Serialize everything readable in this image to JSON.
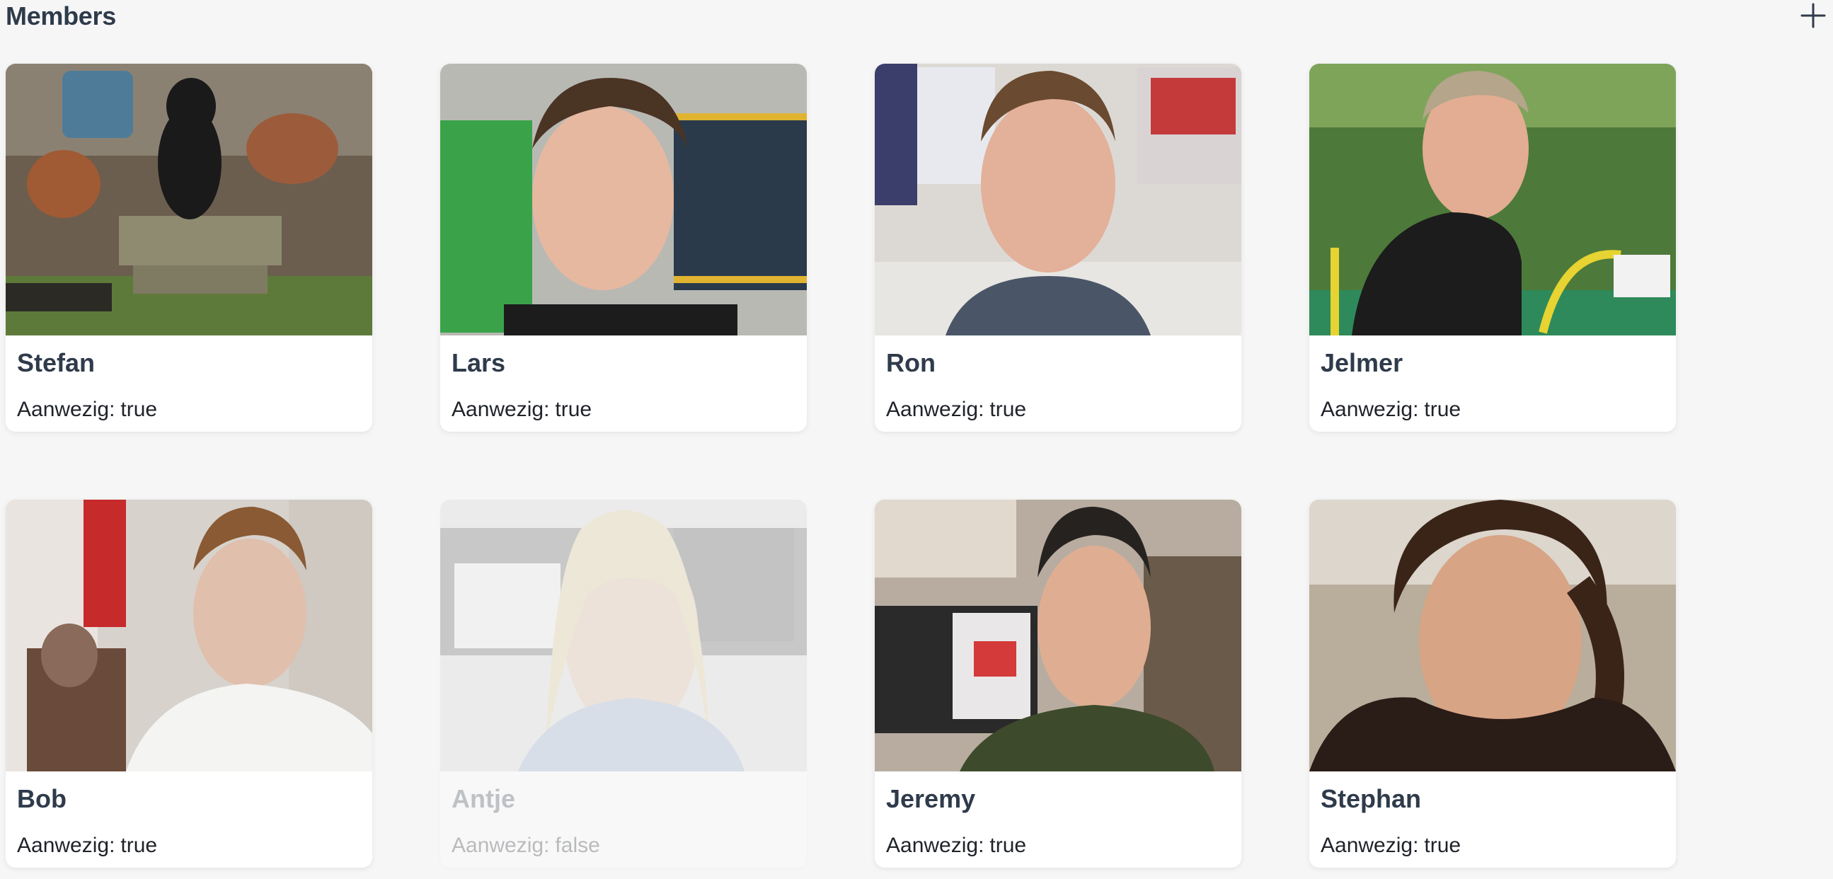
{
  "header": {
    "title": "Members",
    "add_icon": "plus-icon"
  },
  "members": [
    {
      "name": "Stefan",
      "status_label": "Aanwezig:",
      "status_value": "true",
      "present": true,
      "photo": "dog-on-garden-steps-photo"
    },
    {
      "name": "Lars",
      "status_label": "Aanwezig:",
      "status_value": "true",
      "present": true,
      "photo": "portrait-at-computer-photo"
    },
    {
      "name": "Ron",
      "status_label": "Aanwezig:",
      "status_value": "true",
      "present": true,
      "photo": "portrait-at-desk-photo"
    },
    {
      "name": "Jelmer",
      "status_label": "Aanwezig:",
      "status_value": "true",
      "present": true,
      "photo": "portrait-outdoors-photo"
    },
    {
      "name": "Bob",
      "status_label": "Aanwezig:",
      "status_value": "true",
      "present": true,
      "photo": "portrait-in-office-photo"
    },
    {
      "name": "Antje",
      "status_label": "Aanwezig:",
      "status_value": "false",
      "present": false,
      "photo": "portrait-with-glasses-photo"
    },
    {
      "name": "Jeremy",
      "status_label": "Aanwezig:",
      "status_value": "true",
      "present": true,
      "photo": "portrait-at-monitors-photo"
    },
    {
      "name": "Stephan",
      "status_label": "Aanwezig:",
      "status_value": "true",
      "present": true,
      "photo": "selfie-at-beach-photo"
    }
  ],
  "colors": {
    "background": "#f6f6f6",
    "card": "#ffffff",
    "title_text": "#2f3b4b",
    "body_text": "#1f2329"
  }
}
